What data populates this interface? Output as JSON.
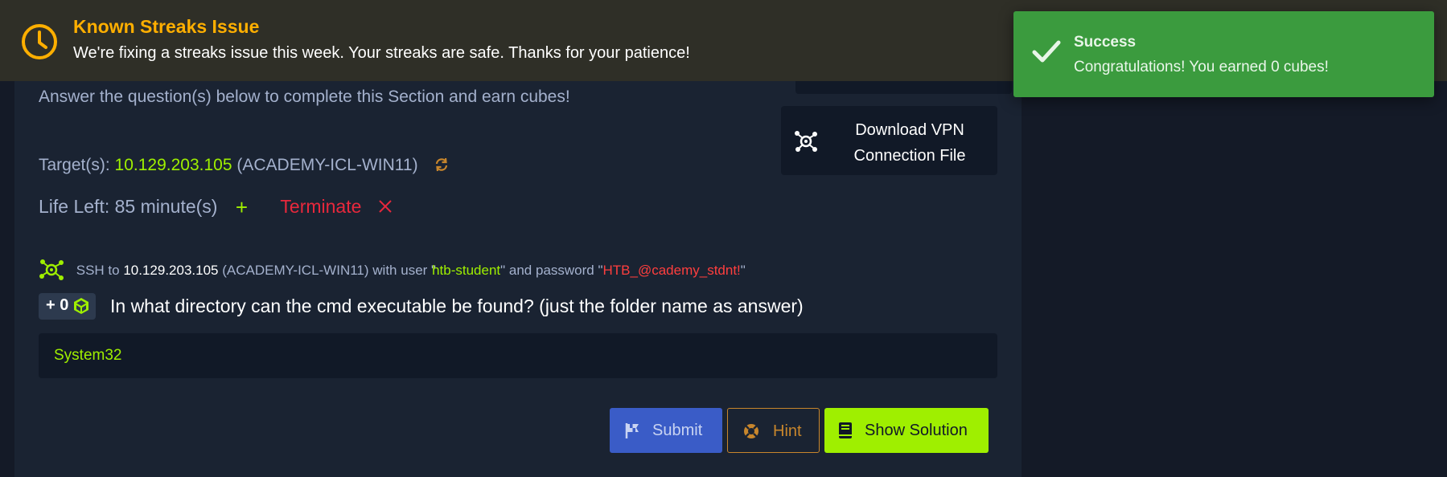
{
  "banner": {
    "title": "Known Streaks Issue",
    "message": "We're fixing a streaks issue this week. Your streaks are safe. Thanks for your patience!"
  },
  "toast": {
    "title": "Success",
    "message": "Congratulations! You earned 0 cubes!"
  },
  "section": {
    "intro": "Answer the question(s) below to complete this Section and earn cubes!",
    "vpn_label": "Download VPN Connection File"
  },
  "target": {
    "label": "Target(s):",
    "ip": "10.129.203.105",
    "host": "(ACADEMY-ICL-WIN11)"
  },
  "life": {
    "label": "Life Left: 85 minute(s)",
    "add": "+",
    "terminate": "Terminate"
  },
  "ssh": {
    "prefix": "SSH to",
    "ip": "10.129.203.105",
    "host": "(ACADEMY-ICL-WIN11)",
    "user_prefix": "with user \"",
    "user": "htb-student",
    "pass_prefix": "\" and password \"",
    "password": "HTB_@cademy_stdnt!",
    "suffix": "\""
  },
  "question": {
    "cubes": "+ 0",
    "text": "In what directory can the cmd executable be found? (just the folder name as answer)",
    "answer": "System32"
  },
  "buttons": {
    "submit": "Submit",
    "hint": "Hint",
    "solution": "Show Solution"
  },
  "colors": {
    "accent_green": "#9fef00",
    "warning_orange": "#ffaf00",
    "danger_red": "#ff3e3e",
    "submit_blue": "#3a5cc7",
    "toast_green": "#3b9b3e"
  }
}
